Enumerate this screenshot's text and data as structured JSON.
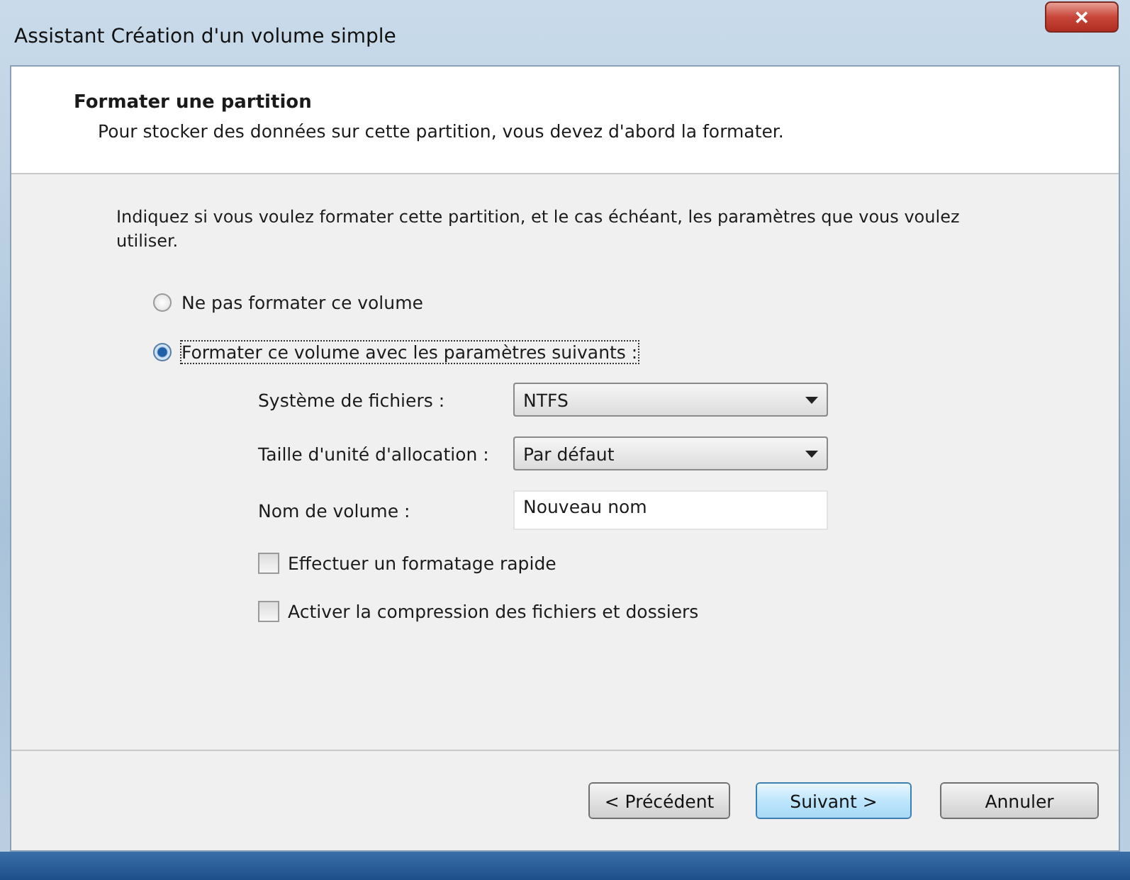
{
  "window": {
    "title": "Assistant Création d'un volume simple",
    "close": "✕"
  },
  "header": {
    "title": "Formater une partition",
    "subtitle": "Pour stocker des données sur cette partition, vous devez d'abord la formater."
  },
  "intro": "Indiquez si vous voulez formater cette partition, et le cas échéant, les paramètres que vous voulez utiliser.",
  "options": [
    {
      "label": "Ne pas formater ce volume",
      "selected": false
    },
    {
      "label": "Formater ce volume avec les paramètres suivants :",
      "selected": true
    }
  ],
  "settings": [
    {
      "kind": "dropdown",
      "label": "Système de fichiers :",
      "value": "NTFS"
    },
    {
      "kind": "dropdown",
      "label": "Taille d'unité d'allocation :",
      "value": "Par défaut"
    },
    {
      "kind": "text",
      "label": "Nom de volume :",
      "value": "Nouveau nom"
    }
  ],
  "checkboxes": [
    {
      "label": "Effectuer un formatage rapide",
      "checked": false
    },
    {
      "label": "Activer la compression des fichiers et dossiers",
      "checked": false
    }
  ],
  "buttons": [
    {
      "label": "< Précédent",
      "default": false
    },
    {
      "label": "Suivant >",
      "default": true
    },
    {
      "label": "Annuler",
      "default": false
    }
  ]
}
